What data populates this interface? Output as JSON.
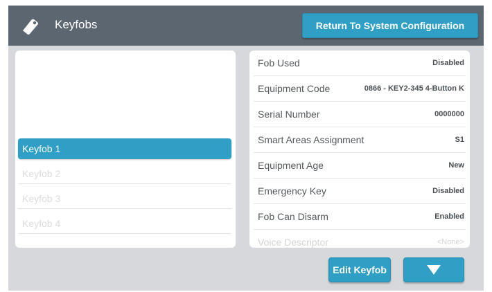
{
  "header": {
    "title": "Keyfobs",
    "return_button": "Return To System Configuration",
    "icon": "tag-icon"
  },
  "keyfob_list": {
    "items": [
      {
        "label": "Keyfob 1",
        "selected": true
      },
      {
        "label": "Keyfob 2",
        "selected": false
      },
      {
        "label": "Keyfob 3",
        "selected": false
      },
      {
        "label": "Keyfob 4",
        "selected": false
      }
    ]
  },
  "details": {
    "rows": [
      {
        "label": "Fob Used",
        "value": "Disabled"
      },
      {
        "label": "Equipment Code",
        "value": "0866 - KEY2-345 4-Button K"
      },
      {
        "label": "Serial Number",
        "value": "0000000"
      },
      {
        "label": "Smart Areas Assignment",
        "value": "S1"
      },
      {
        "label": "Equipment Age",
        "value": "New"
      },
      {
        "label": "Emergency Key",
        "value": "Disabled"
      },
      {
        "label": "Fob Can Disarm",
        "value": "Enabled"
      },
      {
        "label": "Voice Descriptor",
        "value": "<None>"
      }
    ]
  },
  "footer": {
    "edit_button": "Edit Keyfob",
    "down_icon": "chevron-down-icon"
  },
  "colors": {
    "header": "#5b6670",
    "accent": "#2f9fc6",
    "background": "#d6d8db"
  }
}
